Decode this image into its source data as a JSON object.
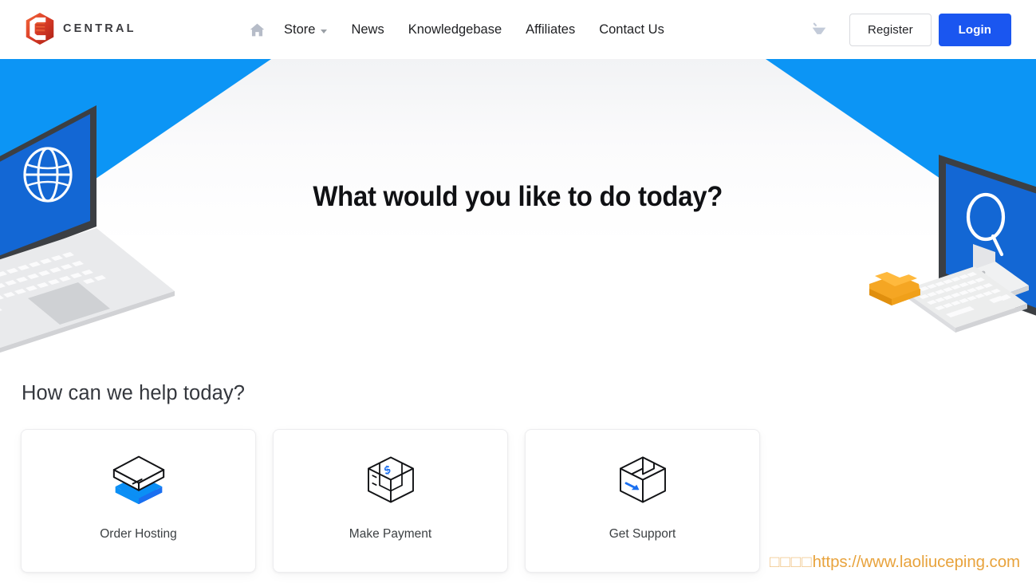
{
  "brand": {
    "name": "CENTRAL",
    "logo_icon": "central-hex-logo-icon"
  },
  "header": {
    "home_icon": "home-icon",
    "nav": [
      {
        "label": "Store",
        "has_dropdown": true,
        "icon": "chevron-down-icon"
      },
      {
        "label": "News",
        "has_dropdown": false
      },
      {
        "label": "Knowledgebase",
        "has_dropdown": false
      },
      {
        "label": "Affiliates",
        "has_dropdown": false
      },
      {
        "label": "Contact Us",
        "has_dropdown": false
      }
    ],
    "cart_icon": "shopping-cart-icon",
    "register_label": "Register",
    "login_label": "Login"
  },
  "hero": {
    "title": "What would you like to do today?",
    "left_illustration_icon": "isometric-laptop-globe-icon",
    "right_illustration_icon": "isometric-desktop-search-icon",
    "folder_icon": "orange-folder-icon",
    "keyboard_icon": "keyboard-icon"
  },
  "help": {
    "title": "How can we help today?",
    "cards": [
      {
        "label": "Order Hosting",
        "icon": "isometric-server-stack-icon"
      },
      {
        "label": "Make Payment",
        "icon": "isometric-box-dollar-icon"
      },
      {
        "label": "Get Support",
        "icon": "isometric-open-box-arrow-icon"
      }
    ]
  },
  "watermark": {
    "prefix": "□□□□",
    "url": "https://www.laoliuceping.com"
  },
  "colors": {
    "banner_blue": "#0c95f5",
    "screen_blue": "#1367d4",
    "login_blue": "#1a56f0",
    "accent_orange": "#e8a33d",
    "logo_red": "#d93b27",
    "icon_blue": "#1a6ff0",
    "folder_orange": "#f5a623",
    "nav_text": "#202124"
  }
}
